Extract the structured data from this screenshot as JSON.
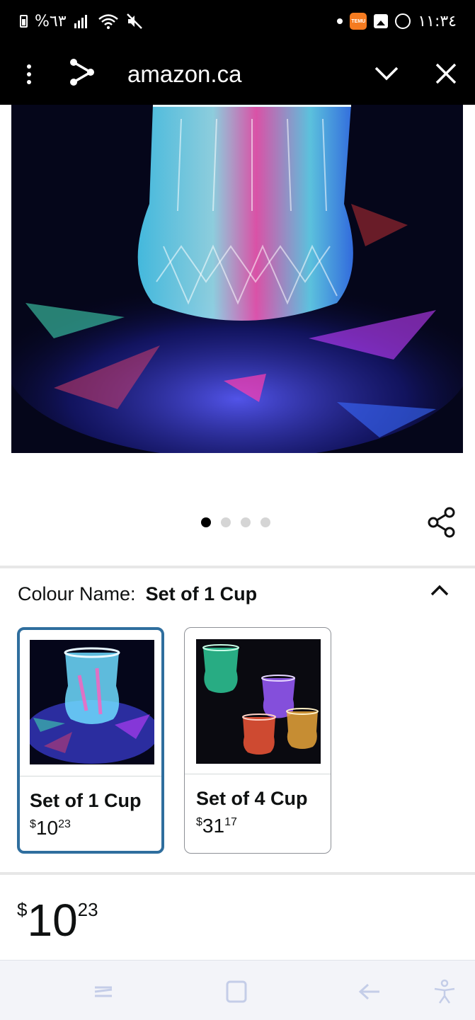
{
  "status_bar": {
    "battery_text": "%٦٣",
    "time": "١١:٣٤",
    "icons": [
      "battery-icon",
      "signal-icon",
      "wifi-icon",
      "mute-icon",
      "notification-dot-icon",
      "temu-icon",
      "gallery-icon",
      "whatsapp-icon"
    ],
    "temu_label": "TEMU"
  },
  "browser": {
    "url": "amazon.ca",
    "icons": [
      "more-vertical-icon",
      "share-icon",
      "chevron-down-icon",
      "close-icon"
    ]
  },
  "hero_image": {
    "subject": "LED light-up crystal cup glowing multicolour on dark background",
    "carousel": {
      "total": 4,
      "active": 0
    }
  },
  "colour": {
    "label": "Colour Name:",
    "selected_value": "Set of 1 Cup"
  },
  "options": [
    {
      "name": "Set of 1 Cup",
      "currency": "$",
      "whole": "10",
      "fraction": "23",
      "selected": true
    },
    {
      "name": "Set of 4 Cup",
      "currency": "$",
      "whole": "31",
      "fraction": "17",
      "selected": false
    }
  ],
  "price": {
    "currency": "$",
    "whole": "10",
    "fraction": "23"
  },
  "nav_bar": {
    "icons": [
      "recent-apps-icon",
      "home-icon",
      "back-icon",
      "accessibility-icon"
    ]
  },
  "colors": {
    "selected_border": "#2f6e9e",
    "text": "#0f1111",
    "divider": "#e7e7e7",
    "nav_icon": "#c4cde8"
  }
}
